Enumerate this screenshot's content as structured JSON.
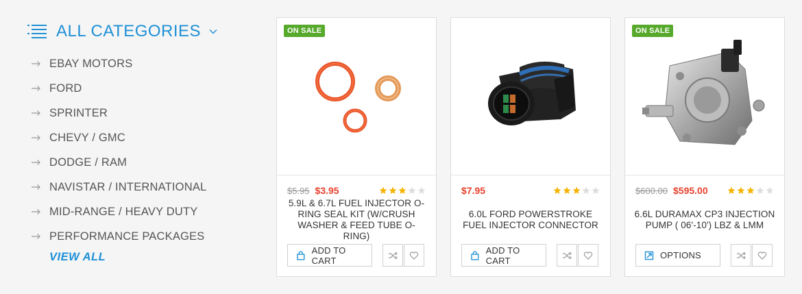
{
  "sidebar": {
    "title": "ALL CATEGORIES",
    "items": [
      {
        "label": "EBAY MOTORS"
      },
      {
        "label": "FORD"
      },
      {
        "label": "SPRINTER"
      },
      {
        "label": "CHEVY / GMC"
      },
      {
        "label": "DODGE / RAM"
      },
      {
        "label": "NAVISTAR / INTERNATIONAL"
      },
      {
        "label": "MID-RANGE / HEAVY DUTY"
      },
      {
        "label": "PERFORMANCE PACKAGES"
      }
    ],
    "view_all": "VIEW ALL"
  },
  "products": [
    {
      "badge": "ON SALE",
      "old_price": "$5.95",
      "price": "$3.95",
      "rating": 3,
      "rating_max": 5,
      "name": "5.9L & 6.7L FUEL INJECTOR O-RING SEAL KIT (W/CRUSH WASHER & FEED TUBE O-RING)",
      "button": "ADD TO CART",
      "button_icon": "cart-bag-icon",
      "image": "o-ring-seal-kit"
    },
    {
      "badge": "",
      "old_price": "",
      "price": "$7.95",
      "rating": 3,
      "rating_max": 5,
      "name": "6.0L FORD POWERSTROKE FUEL INJECTOR CONNECTOR",
      "button": "ADD TO CART",
      "button_icon": "cart-bag-icon",
      "image": "injector-connector"
    },
    {
      "badge": "ON SALE",
      "old_price": "$600.00",
      "price": "$595.00",
      "rating": 3,
      "rating_max": 5,
      "name": "6.6L DURAMAX CP3 INJECTION PUMP ( 06'-10') LBZ & LMM",
      "button": "OPTIONS",
      "button_icon": "options-icon",
      "image": "injection-pump"
    }
  ],
  "colors": {
    "accent": "#1e90d6",
    "sale": "#56a92b",
    "price": "#e8412d",
    "star_on": "#f5b301",
    "star_off": "#dddddd"
  }
}
